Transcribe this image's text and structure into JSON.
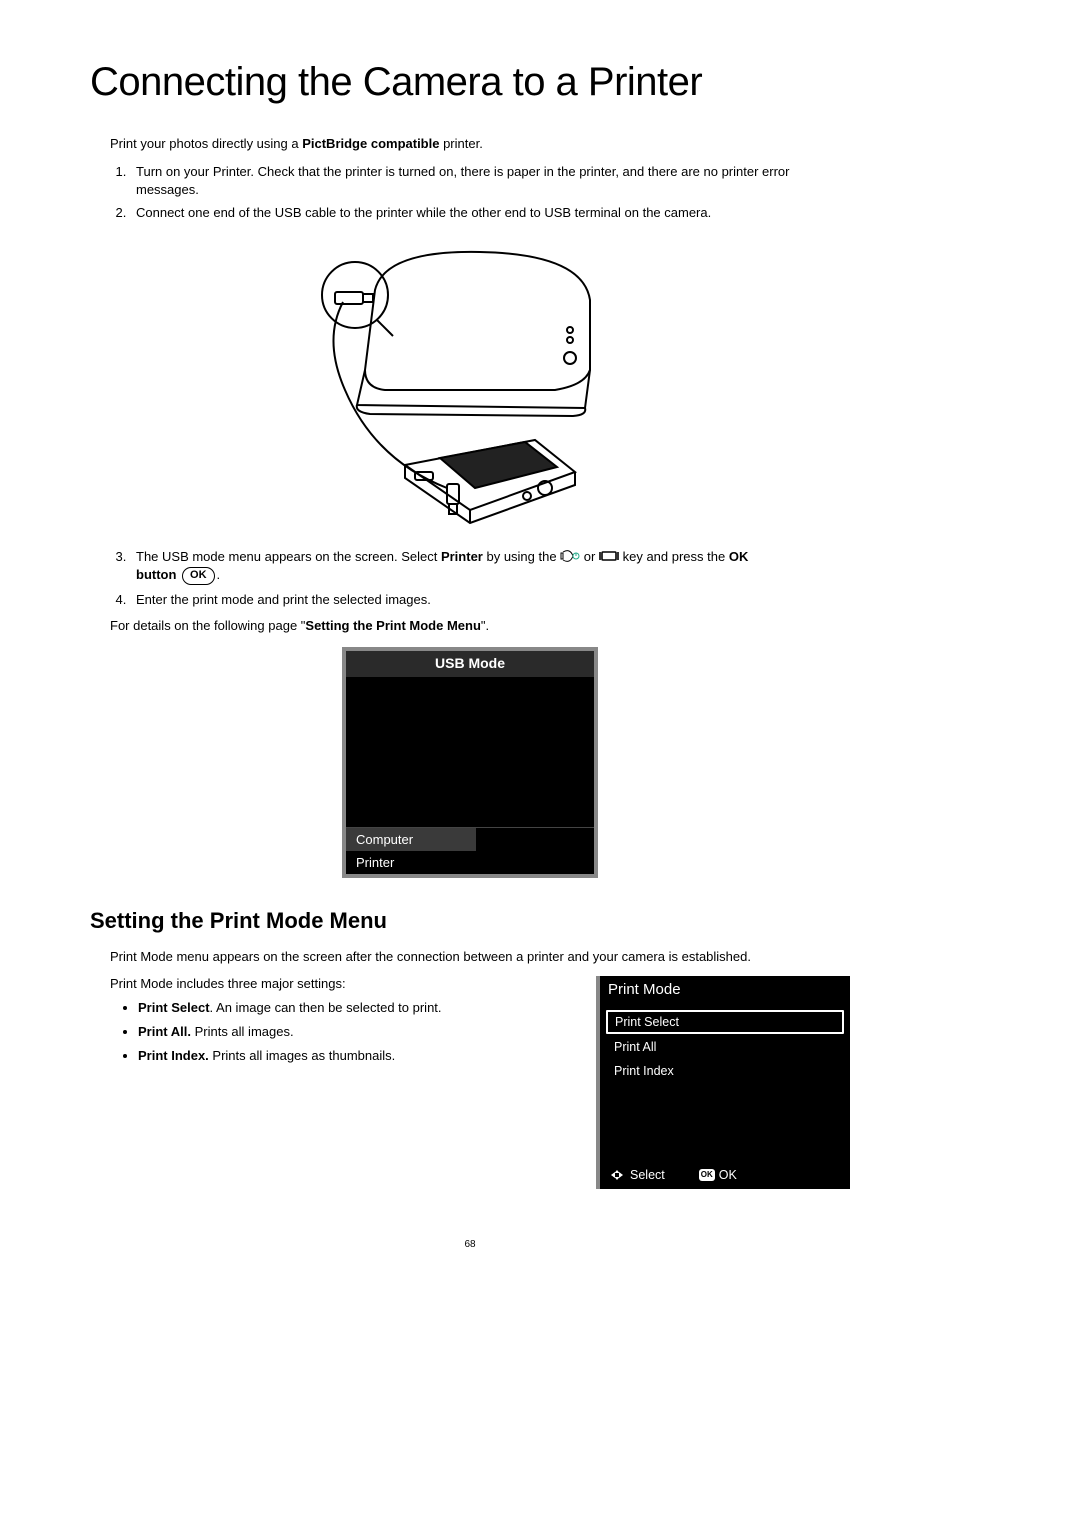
{
  "title": "Connecting the Camera to a Printer",
  "intro": {
    "prefix": "Print your photos directly using a ",
    "bold": "PictBridge compatible",
    "suffix": " printer."
  },
  "steps": {
    "s1": "Turn on your Printer. Check that the printer is turned on, there is paper in the printer, and there are no printer error messages.",
    "s2": "Connect one end of the USB cable to the printer while the other end to USB terminal on the camera.",
    "s3": {
      "a": "The USB mode menu appears on the screen. Select ",
      "printer": "Printer",
      "b": " by using the ",
      "c": " or ",
      "d": " key and press the ",
      "ok": "OK",
      "button_word": "button",
      "ok_icon": "OK",
      "period": "."
    },
    "s4": "Enter the print mode and print the selected images."
  },
  "reference": {
    "a": "For details on the following page \"",
    "b": "Setting the Print Mode Menu",
    "c": "\"."
  },
  "usb_mode": {
    "title": "USB Mode",
    "opt_computer": "Computer",
    "opt_printer": "Printer"
  },
  "section2_title": "Setting the Print Mode Menu",
  "section2_intro": "Print Mode menu appears on the screen after the connection between a printer and your camera is established.",
  "section2_sub": "Print Mode includes three major settings:",
  "bullets": {
    "b1": {
      "label": "Print Select",
      "sep": ". ",
      "desc": "An image can then be selected to print."
    },
    "b2": {
      "label": "Print All.",
      "sep": " ",
      "desc": "Prints all images."
    },
    "b3": {
      "label": "Print Index.",
      "sep": " ",
      "desc": "Prints all images as thumbnails."
    }
  },
  "print_mode": {
    "title": "Print Mode",
    "i1": "Print Select",
    "i2": "Print All",
    "i3": "Print Index",
    "footer_select": "Select",
    "footer_ok_badge": "OK",
    "footer_ok": "OK"
  },
  "page_number": "68"
}
